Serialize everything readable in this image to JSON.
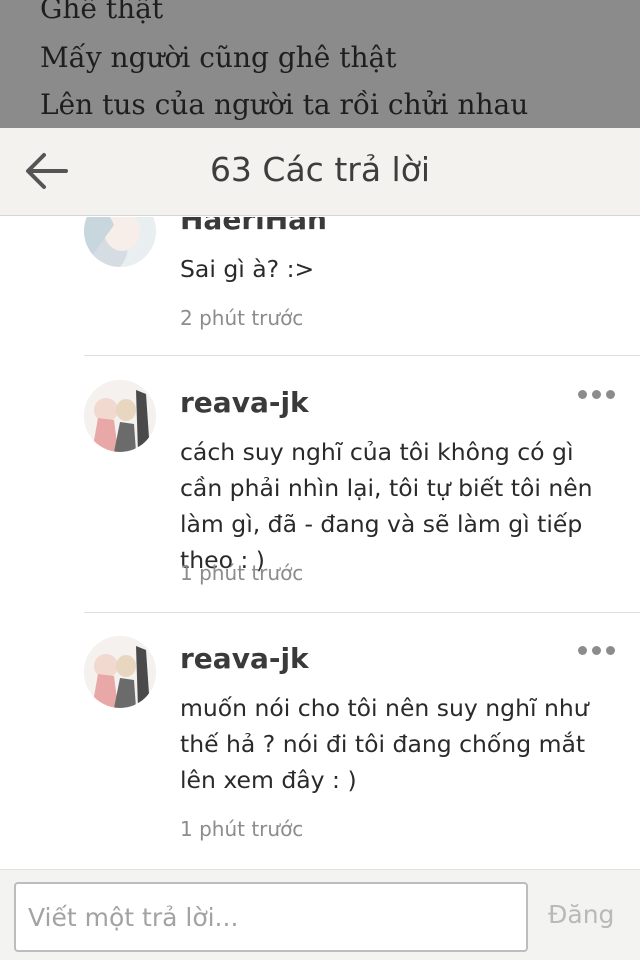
{
  "background_story": {
    "lines": [
      "Ghê thật",
      "Mấy người cũng ghê thật",
      "Lên tus của người ta rồi chửi nhau"
    ]
  },
  "header": {
    "back_icon": "arrow-left-icon",
    "title": "63 Các trả lời"
  },
  "comments": [
    {
      "username": "HaeriHan",
      "text": "Sai gì à? :>",
      "time": "2 phút trước",
      "avatar": "user-avatar"
    },
    {
      "username": "reava-jk",
      "text": "cách suy nghĩ của tôi không có gì cần phải nhìn lại, tôi tự biết tôi nên làm gì, đã - đang và sẽ làm gì tiếp theo : )",
      "time": "1 phút trước",
      "avatar": "user-avatar",
      "more_icon": "more-horizontal-icon"
    },
    {
      "username": "reava-jk",
      "text": "muốn nói cho tôi nên suy nghĩ như thế hả ? nói đi tôi đang chống mắt lên xem đây : )",
      "time": "1 phút trước",
      "avatar": "user-avatar",
      "more_icon": "more-horizontal-icon"
    }
  ],
  "reply": {
    "placeholder": "Viết một trả lời...",
    "post_label": "Đăng"
  },
  "colors": {
    "header_bg": "#f3f2ee",
    "backdrop": "#8b8b8b",
    "text": "#2a2a2a",
    "muted": "#8c8c8c"
  }
}
